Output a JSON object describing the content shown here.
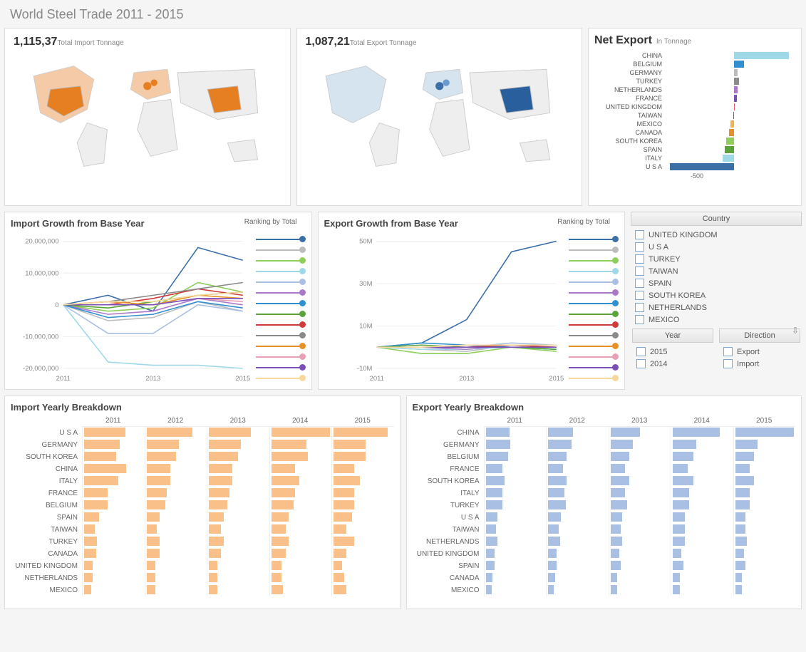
{
  "title": "World Steel Trade 2011 - 2015",
  "import_map": {
    "value": "1,115,37",
    "label": "Total Import Tonnage"
  },
  "export_map": {
    "value": "1,087,21",
    "label": "Total Export Tonnage"
  },
  "net_export": {
    "title": "Net Export",
    "sub": "In Tonnage",
    "axis_label": "-500",
    "countries": [
      {
        "name": "CHINA",
        "v": 430,
        "color": "#9fd9e8"
      },
      {
        "name": "BELGIUM",
        "v": 80,
        "color": "#2f8fd0"
      },
      {
        "name": "GERMANY",
        "v": 30,
        "color": "#bcbcbc"
      },
      {
        "name": "TURKEY",
        "v": 40,
        "color": "#8a8a8a"
      },
      {
        "name": "NETHERLANDS",
        "v": 25,
        "color": "#a978c9"
      },
      {
        "name": "FRANCE",
        "v": 20,
        "color": "#7a4fb7"
      },
      {
        "name": "UNITED KINGDOM",
        "v": 5,
        "color": "#e85c6a"
      },
      {
        "name": "TAIWAN",
        "v": -5,
        "color": "#d03a3a"
      },
      {
        "name": "MEXICO",
        "v": -30,
        "color": "#f3b24a"
      },
      {
        "name": "CANADA",
        "v": -40,
        "color": "#e89026"
      },
      {
        "name": "SOUTH KOREA",
        "v": -60,
        "color": "#8fce5a"
      },
      {
        "name": "SPAIN",
        "v": -70,
        "color": "#5aa33a"
      },
      {
        "name": "ITALY",
        "v": -90,
        "color": "#9fd9e8"
      },
      {
        "name": "U S A",
        "v": -500,
        "color": "#3a6fa8"
      }
    ]
  },
  "import_growth": {
    "title": "Import Growth from Base Year",
    "rank": "Ranking by Total",
    "yticks": [
      "20,000,000",
      "10,000,000",
      "0",
      "-10,000,000",
      "-20,000,000"
    ],
    "xticks": [
      "2011",
      "2013",
      "2015"
    ]
  },
  "export_growth": {
    "title": "Export Growth from Base Year",
    "rank": "Ranking by Total",
    "yticks": [
      "50M",
      "30M",
      "10M",
      "-10M"
    ],
    "xticks": [
      "2011",
      "2013",
      "2015"
    ]
  },
  "rank_colors": [
    "#3a6fa8",
    "#bcbcbc",
    "#8fce5a",
    "#9fd9e8",
    "#a9bfe4",
    "#a978c9",
    "#2f8fd0",
    "#5aa33a",
    "#d03a3a",
    "#8a8a8a",
    "#e89026",
    "#e9a0b5",
    "#7a4fb7",
    "#f5d89a"
  ],
  "filters": {
    "country_head": "Country",
    "countries": [
      "UNITED KINGDOM",
      "U S A",
      "TURKEY",
      "TAIWAN",
      "SPAIN",
      "SOUTH KOREA",
      "NETHERLANDS",
      "MEXICO"
    ],
    "year_head": "Year",
    "years": [
      "2015",
      "2014"
    ],
    "dir_head": "Direction",
    "dirs": [
      "Export",
      "Import"
    ]
  },
  "import_break": {
    "title": "Import Yearly Breakdown",
    "years": [
      "2011",
      "2012",
      "2013",
      "2014",
      "2015"
    ],
    "rows": [
      {
        "c": "U S A",
        "v": [
          70,
          78,
          72,
          100,
          92
        ]
      },
      {
        "c": "GERMANY",
        "v": [
          60,
          55,
          55,
          60,
          55
        ]
      },
      {
        "c": "SOUTH KOREA",
        "v": [
          55,
          50,
          50,
          62,
          55
        ]
      },
      {
        "c": "CHINA",
        "v": [
          72,
          40,
          40,
          40,
          35
        ]
      },
      {
        "c": "ITALY",
        "v": [
          58,
          40,
          40,
          48,
          45
        ]
      },
      {
        "c": "FRANCE",
        "v": [
          40,
          35,
          35,
          40,
          35
        ]
      },
      {
        "c": "BELGIUM",
        "v": [
          40,
          32,
          32,
          38,
          35
        ]
      },
      {
        "c": "SPAIN",
        "v": [
          25,
          22,
          25,
          30,
          32
        ]
      },
      {
        "c": "TAIWAN",
        "v": [
          18,
          18,
          20,
          25,
          22
        ]
      },
      {
        "c": "TURKEY",
        "v": [
          22,
          22,
          25,
          30,
          35
        ]
      },
      {
        "c": "CANADA",
        "v": [
          20,
          22,
          20,
          25,
          22
        ]
      },
      {
        "c": "UNITED KINGDOM",
        "v": [
          15,
          15,
          15,
          18,
          15
        ]
      },
      {
        "c": "NETHERLANDS",
        "v": [
          15,
          15,
          15,
          18,
          18
        ]
      },
      {
        "c": "MEXICO",
        "v": [
          12,
          15,
          15,
          20,
          22
        ]
      }
    ]
  },
  "export_break": {
    "title": "Export Yearly Breakdown",
    "years": [
      "2011",
      "2012",
      "2013",
      "2014",
      "2015"
    ],
    "rows": [
      {
        "c": "CHINA",
        "v": [
          40,
          42,
          50,
          80,
          100
        ]
      },
      {
        "c": "GERMANY",
        "v": [
          42,
          40,
          38,
          40,
          38
        ]
      },
      {
        "c": "BELGIUM",
        "v": [
          38,
          32,
          32,
          35,
          32
        ]
      },
      {
        "c": "FRANCE",
        "v": [
          28,
          25,
          25,
          25,
          25
        ]
      },
      {
        "c": "SOUTH KOREA",
        "v": [
          32,
          32,
          32,
          35,
          32
        ]
      },
      {
        "c": "ITALY",
        "v": [
          28,
          28,
          25,
          28,
          25
        ]
      },
      {
        "c": "TURKEY",
        "v": [
          28,
          30,
          28,
          28,
          25
        ]
      },
      {
        "c": "U S A",
        "v": [
          20,
          22,
          20,
          20,
          18
        ]
      },
      {
        "c": "TAIWAN",
        "v": [
          18,
          18,
          18,
          20,
          18
        ]
      },
      {
        "c": "NETHERLANDS",
        "v": [
          20,
          20,
          20,
          20,
          20
        ]
      },
      {
        "c": "UNITED KINGDOM",
        "v": [
          15,
          15,
          15,
          15,
          15
        ]
      },
      {
        "c": "SPAIN",
        "v": [
          15,
          15,
          18,
          18,
          18
        ]
      },
      {
        "c": "CANADA",
        "v": [
          12,
          12,
          12,
          12,
          12
        ]
      },
      {
        "c": "MEXICO",
        "v": [
          10,
          10,
          12,
          12,
          12
        ]
      }
    ]
  },
  "chart_data": [
    {
      "type": "bar",
      "title": "Net Export",
      "ylabel": "In Tonnage",
      "categories": [
        "CHINA",
        "BELGIUM",
        "GERMANY",
        "TURKEY",
        "NETHERLANDS",
        "FRANCE",
        "UNITED KINGDOM",
        "TAIWAN",
        "MEXICO",
        "CANADA",
        "SOUTH KOREA",
        "SPAIN",
        "ITALY",
        "U S A"
      ],
      "values": [
        430,
        80,
        30,
        40,
        25,
        20,
        5,
        -5,
        -30,
        -40,
        -60,
        -70,
        -90,
        -500
      ]
    },
    {
      "type": "line",
      "title": "Import Growth from Base Year",
      "xlabel": "Year",
      "x": [
        2011,
        2012,
        2013,
        2014,
        2015
      ],
      "ylim": [
        -20000000,
        20000000
      ],
      "series": [
        {
          "name": "U S A",
          "values": [
            0,
            3000000,
            -2000000,
            18000000,
            14000000
          ]
        },
        {
          "name": "GERMANY",
          "values": [
            0,
            -5000000,
            -4000000,
            1000000,
            -2000000
          ]
        },
        {
          "name": "SOUTH KOREA",
          "values": [
            0,
            -2000000,
            -1000000,
            7000000,
            4000000
          ]
        },
        {
          "name": "CHINA",
          "values": [
            0,
            -18000000,
            -19000000,
            -19000000,
            -20000000
          ]
        },
        {
          "name": "ITALY",
          "values": [
            0,
            -9000000,
            -9000000,
            0,
            -2000000
          ]
        },
        {
          "name": "FRANCE",
          "values": [
            0,
            -3000000,
            -2000000,
            2000000,
            0
          ]
        },
        {
          "name": "BELGIUM",
          "values": [
            0,
            -4000000,
            -3000000,
            1000000,
            -1000000
          ]
        },
        {
          "name": "SPAIN",
          "values": [
            0,
            -1000000,
            1000000,
            3000000,
            4000000
          ]
        },
        {
          "name": "TAIWAN",
          "values": [
            0,
            0,
            2000000,
            5000000,
            3000000
          ]
        },
        {
          "name": "TURKEY",
          "values": [
            0,
            1000000,
            3000000,
            5000000,
            7000000
          ]
        },
        {
          "name": "CANADA",
          "values": [
            0,
            1000000,
            0,
            3000000,
            2000000
          ]
        },
        {
          "name": "UNITED KINGDOM",
          "values": [
            0,
            0,
            0,
            2000000,
            1000000
          ]
        },
        {
          "name": "NETHERLANDS",
          "values": [
            0,
            0,
            0,
            2000000,
            2000000
          ]
        },
        {
          "name": "MEXICO",
          "values": [
            0,
            1000000,
            1000000,
            3000000,
            4000000
          ]
        }
      ]
    },
    {
      "type": "line",
      "title": "Export Growth from Base Year",
      "xlabel": "Year",
      "x": [
        2011,
        2012,
        2013,
        2014,
        2015
      ],
      "ylim": [
        -10000000,
        50000000
      ],
      "series": [
        {
          "name": "CHINA",
          "values": [
            0,
            2000000,
            13000000,
            45000000,
            50000000
          ]
        },
        {
          "name": "GERMANY",
          "values": [
            0,
            -1000000,
            -2000000,
            1000000,
            -1000000
          ]
        },
        {
          "name": "BELGIUM",
          "values": [
            0,
            -3000000,
            -3000000,
            0,
            -2000000
          ]
        },
        {
          "name": "FRANCE",
          "values": [
            0,
            -1000000,
            -1000000,
            0,
            -1000000
          ]
        },
        {
          "name": "SOUTH KOREA",
          "values": [
            0,
            0,
            0,
            2000000,
            1000000
          ]
        },
        {
          "name": "ITALY",
          "values": [
            0,
            0,
            -1000000,
            1000000,
            0
          ]
        },
        {
          "name": "TURKEY",
          "values": [
            0,
            2000000,
            1000000,
            0,
            -1000000
          ]
        },
        {
          "name": "U S A",
          "values": [
            0,
            1000000,
            0,
            0,
            -1000000
          ]
        },
        {
          "name": "TAIWAN",
          "values": [
            0,
            0,
            0,
            1000000,
            0
          ]
        },
        {
          "name": "NETHERLANDS",
          "values": [
            0,
            0,
            0,
            0,
            0
          ]
        },
        {
          "name": "UNITED KINGDOM",
          "values": [
            0,
            0,
            0,
            0,
            0
          ]
        },
        {
          "name": "SPAIN",
          "values": [
            0,
            0,
            1000000,
            1000000,
            1000000
          ]
        },
        {
          "name": "CANADA",
          "values": [
            0,
            0,
            0,
            0,
            0
          ]
        },
        {
          "name": "MEXICO",
          "values": [
            0,
            0,
            1000000,
            1000000,
            1000000
          ]
        }
      ]
    },
    {
      "type": "bar",
      "title": "Import Yearly Breakdown",
      "categories": [
        "U S A",
        "GERMANY",
        "SOUTH KOREA",
        "CHINA",
        "ITALY",
        "FRANCE",
        "BELGIUM",
        "SPAIN",
        "TAIWAN",
        "TURKEY",
        "CANADA",
        "UNITED KINGDOM",
        "NETHERLANDS",
        "MEXICO"
      ],
      "x": [
        "2011",
        "2012",
        "2013",
        "2014",
        "2015"
      ],
      "series": [
        {
          "name": "2011",
          "values": [
            70,
            60,
            55,
            72,
            58,
            40,
            40,
            25,
            18,
            22,
            20,
            15,
            15,
            12
          ]
        },
        {
          "name": "2012",
          "values": [
            78,
            55,
            50,
            40,
            40,
            35,
            32,
            22,
            18,
            22,
            22,
            15,
            15,
            15
          ]
        },
        {
          "name": "2013",
          "values": [
            72,
            55,
            50,
            40,
            40,
            35,
            32,
            25,
            20,
            25,
            20,
            15,
            15,
            15
          ]
        },
        {
          "name": "2014",
          "values": [
            100,
            60,
            62,
            40,
            48,
            40,
            38,
            30,
            25,
            30,
            25,
            18,
            18,
            20
          ]
        },
        {
          "name": "2015",
          "values": [
            92,
            55,
            55,
            35,
            45,
            35,
            35,
            32,
            22,
            35,
            22,
            15,
            18,
            22
          ]
        }
      ]
    },
    {
      "type": "bar",
      "title": "Export Yearly Breakdown",
      "categories": [
        "CHINA",
        "GERMANY",
        "BELGIUM",
        "FRANCE",
        "SOUTH KOREA",
        "ITALY",
        "TURKEY",
        "U S A",
        "TAIWAN",
        "NETHERLANDS",
        "UNITED KINGDOM",
        "SPAIN",
        "CANADA",
        "MEXICO"
      ],
      "x": [
        "2011",
        "2012",
        "2013",
        "2014",
        "2015"
      ],
      "series": [
        {
          "name": "2011",
          "values": [
            40,
            42,
            38,
            28,
            32,
            28,
            28,
            20,
            18,
            20,
            15,
            15,
            12,
            10
          ]
        },
        {
          "name": "2012",
          "values": [
            42,
            40,
            32,
            25,
            32,
            28,
            30,
            22,
            18,
            20,
            15,
            15,
            12,
            10
          ]
        },
        {
          "name": "2013",
          "values": [
            50,
            38,
            32,
            25,
            32,
            25,
            28,
            20,
            18,
            20,
            15,
            18,
            12,
            12
          ]
        },
        {
          "name": "2014",
          "values": [
            80,
            40,
            35,
            25,
            35,
            28,
            28,
            20,
            20,
            20,
            15,
            18,
            12,
            12
          ]
        },
        {
          "name": "2015",
          "values": [
            100,
            38,
            32,
            25,
            32,
            25,
            25,
            18,
            18,
            20,
            15,
            18,
            12,
            12
          ]
        }
      ]
    }
  ]
}
